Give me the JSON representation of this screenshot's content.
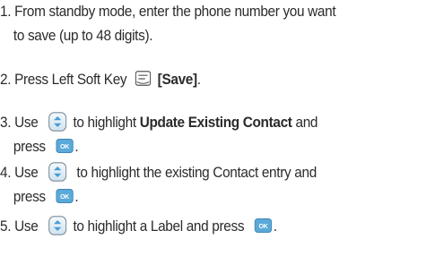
{
  "steps": [
    {
      "number": "1.",
      "line1": "From standby mode, enter the phone number you want",
      "line2": "to save (up to 48 digits)."
    },
    {
      "number": "2.",
      "text_before": "Press Left Soft Key",
      "bold": "[Save]",
      "text_after": "."
    },
    {
      "number": "3.",
      "use": "Use",
      "text_before": "to highlight",
      "bold": "Update Existing Contact",
      "text_after": "and",
      "press": "press",
      "end": "."
    },
    {
      "number": "4.",
      "use": "Use",
      "text": "to highlight the existing Contact entry and",
      "press": "press",
      "end": "."
    },
    {
      "number": "5.",
      "use": "Use",
      "text": "to highlight a Label and press",
      "end": "."
    }
  ],
  "icons": {
    "ok_label": "OK",
    "softkey": "left-soft-key-icon",
    "navkey": "up-down-navigation-key-icon",
    "okkey": "ok-key-icon",
    "accent_color": "#5aa9d8"
  }
}
